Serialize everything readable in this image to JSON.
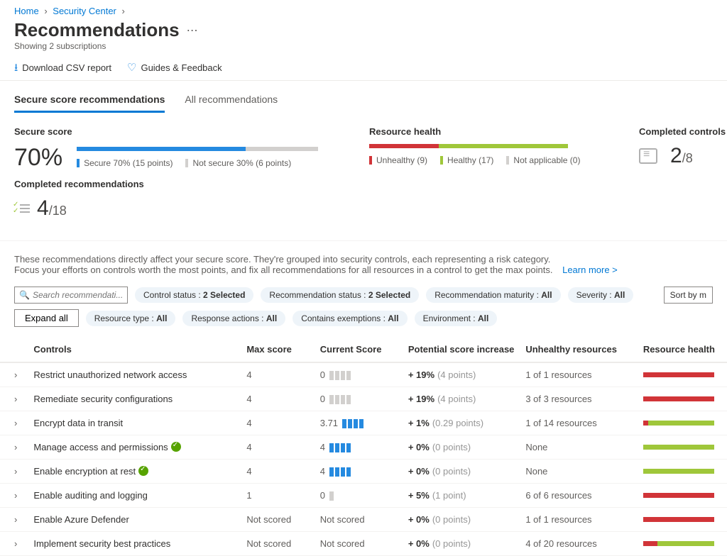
{
  "breadcrumb": {
    "home": "Home",
    "security_center": "Security Center"
  },
  "title": "Recommendations",
  "subtitle": "Showing 2 subscriptions",
  "toolbar": {
    "download": "Download CSV report",
    "guides": "Guides & Feedback"
  },
  "tabs": {
    "secure": "Secure score recommendations",
    "all": "All recommendations"
  },
  "secure_score": {
    "label": "Secure score",
    "percent": "70%",
    "fill_pct": 70,
    "secure_legend": "Secure 70% (15 points)",
    "not_secure_legend": "Not secure 30% (6 points)"
  },
  "resource_health": {
    "label": "Resource health",
    "unhealthy": "Unhealthy (9)",
    "healthy": "Healthy (17)",
    "na": "Not applicable (0)",
    "red_pct": 35,
    "green_pct": 65
  },
  "completed_controls": {
    "label": "Completed controls",
    "num": "2",
    "den": "/8"
  },
  "completed_recs": {
    "label": "Completed recommendations",
    "num": "4",
    "den": "/18"
  },
  "description": {
    "line1": "These recommendations directly affect your secure score. They're grouped into security controls, each representing a risk category.",
    "line2": "Focus your efforts on controls worth the most points, and fix all recommendations for all resources in a control to get the max points.",
    "learn_more": "Learn more >"
  },
  "search": {
    "placeholder": "Search recommendati..."
  },
  "expand_all": "Expand all",
  "sort_by": "Sort by m",
  "filters": {
    "control_status": {
      "label": "Control status : ",
      "value": "2 Selected"
    },
    "rec_status": {
      "label": "Recommendation status : ",
      "value": "2 Selected"
    },
    "maturity": {
      "label": "Recommendation maturity : ",
      "value": "All"
    },
    "severity": {
      "label": "Severity : ",
      "value": "All"
    },
    "resource_type": {
      "label": "Resource type : ",
      "value": "All"
    },
    "response": {
      "label": "Response actions : ",
      "value": "All"
    },
    "exemptions": {
      "label": "Contains exemptions : ",
      "value": "All"
    },
    "environment": {
      "label": "Environment : ",
      "value": "All"
    }
  },
  "headers": {
    "controls": "Controls",
    "max": "Max score",
    "current": "Current Score",
    "potential": "Potential score increase",
    "unhealthy": "Unhealthy resources",
    "health": "Resource health"
  },
  "rows": [
    {
      "name": "Restrict unauthorized network access",
      "max": "4",
      "current": "0",
      "bars": 0,
      "max_bars": 4,
      "inc_pct": "+ 19%",
      "inc_pts": "(4 points)",
      "unhealthy": "1 of 1 resources",
      "red": 100,
      "checked": false,
      "scored": true
    },
    {
      "name": "Remediate security configurations",
      "max": "4",
      "current": "0",
      "bars": 0,
      "max_bars": 4,
      "inc_pct": "+ 19%",
      "inc_pts": "(4 points)",
      "unhealthy": "3 of 3 resources",
      "red": 100,
      "checked": false,
      "scored": true
    },
    {
      "name": "Encrypt data in transit",
      "max": "4",
      "current": "3.71",
      "bars": 4,
      "max_bars": 4,
      "inc_pct": "+ 1%",
      "inc_pts": "(0.29 points)",
      "unhealthy": "1 of 14 resources",
      "red": 7,
      "checked": false,
      "scored": true
    },
    {
      "name": "Manage access and permissions",
      "max": "4",
      "current": "4",
      "bars": 4,
      "max_bars": 4,
      "inc_pct": "+ 0%",
      "inc_pts": "(0 points)",
      "unhealthy": "None",
      "red": 0,
      "checked": true,
      "scored": true
    },
    {
      "name": "Enable encryption at rest",
      "max": "4",
      "current": "4",
      "bars": 4,
      "max_bars": 4,
      "inc_pct": "+ 0%",
      "inc_pts": "(0 points)",
      "unhealthy": "None",
      "red": 0,
      "checked": true,
      "scored": true
    },
    {
      "name": "Enable auditing and logging",
      "max": "1",
      "current": "0",
      "bars": 0,
      "max_bars": 1,
      "inc_pct": "+ 5%",
      "inc_pts": "(1 point)",
      "unhealthy": "6 of 6 resources",
      "red": 100,
      "checked": false,
      "scored": true
    },
    {
      "name": "Enable Azure Defender",
      "max": "Not scored",
      "current": "Not scored",
      "bars": 0,
      "max_bars": 0,
      "inc_pct": "+ 0%",
      "inc_pts": "(0 points)",
      "unhealthy": "1 of 1 resources",
      "red": 100,
      "checked": false,
      "scored": false
    },
    {
      "name": "Implement security best practices",
      "max": "Not scored",
      "current": "Not scored",
      "bars": 0,
      "max_bars": 0,
      "inc_pct": "+ 0%",
      "inc_pts": "(0 points)",
      "unhealthy": "4 of 20 resources",
      "red": 20,
      "checked": false,
      "scored": false
    }
  ]
}
